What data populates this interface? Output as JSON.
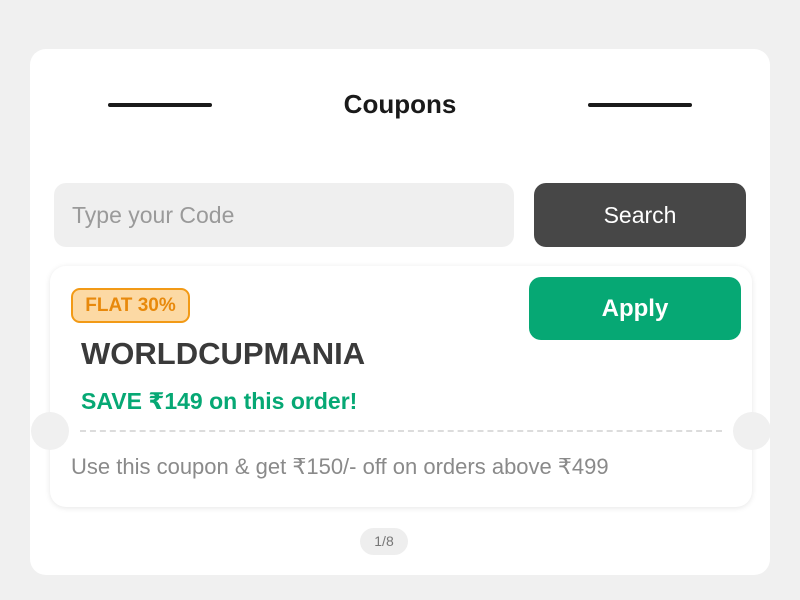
{
  "header": {
    "title": "Coupons"
  },
  "search": {
    "placeholder": "Type your Code",
    "value": "",
    "button_label": "Search"
  },
  "coupon": {
    "badge": "FLAT 30%",
    "code": "WORLDCUPMANIA",
    "savings_text": "SAVE ₹149 on this order!",
    "terms": "Use this coupon & get ₹150/- off on orders above ₹499",
    "apply_label": "Apply"
  },
  "pagination": {
    "label": "1/8"
  },
  "colors": {
    "accent_green": "#06a874",
    "badge_orange": "#f29a16",
    "badge_fill": "#fcd9a4",
    "search_button": "#474747",
    "background": "#f0f0f0"
  }
}
